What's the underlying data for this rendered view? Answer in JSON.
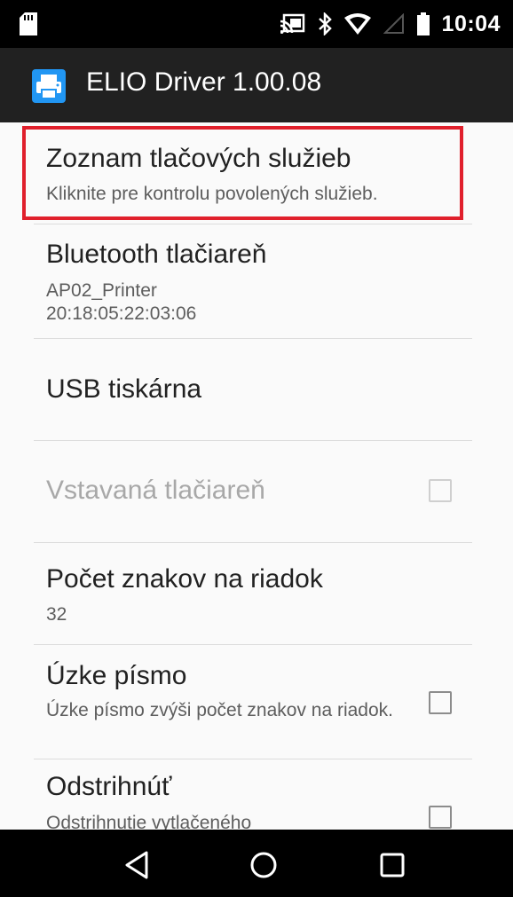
{
  "status_bar": {
    "time": "10:04",
    "icons": [
      "sd-card-icon",
      "cast-icon",
      "bluetooth-icon",
      "wifi-icon",
      "signal-icon",
      "battery-icon"
    ]
  },
  "app_bar": {
    "title": "ELIO Driver 1.00.08",
    "icon": "printer-icon"
  },
  "settings": {
    "service_list": {
      "title": "Zoznam tlačových služieb",
      "summary": "Kliknite pre kontrolu povolených služieb."
    },
    "bluetooth_printer": {
      "title": "Bluetooth tlačiareň",
      "name": "AP02_Printer",
      "address": "20:18:05:22:03:06"
    },
    "usb_printer": {
      "title": "USB tiskárna"
    },
    "builtin_printer": {
      "title": "Vstavaná tlačiareň",
      "checked": false,
      "enabled": false
    },
    "chars_per_line": {
      "title": "Počet znakov na riadok",
      "value": "32"
    },
    "narrow_font": {
      "title": "Úzke písmo",
      "summary": "Úzke písmo zvýši počet znakov na riadok.",
      "checked": false
    },
    "cut": {
      "title": "Odstrihnúť",
      "summary": "Odstrihnutie vytlačeného",
      "checked": false
    }
  },
  "nav_bar": {
    "buttons": [
      "back-icon",
      "home-icon",
      "recents-icon"
    ]
  },
  "colors": {
    "highlight": "#e0202c",
    "app_icon": "#2196f3"
  }
}
